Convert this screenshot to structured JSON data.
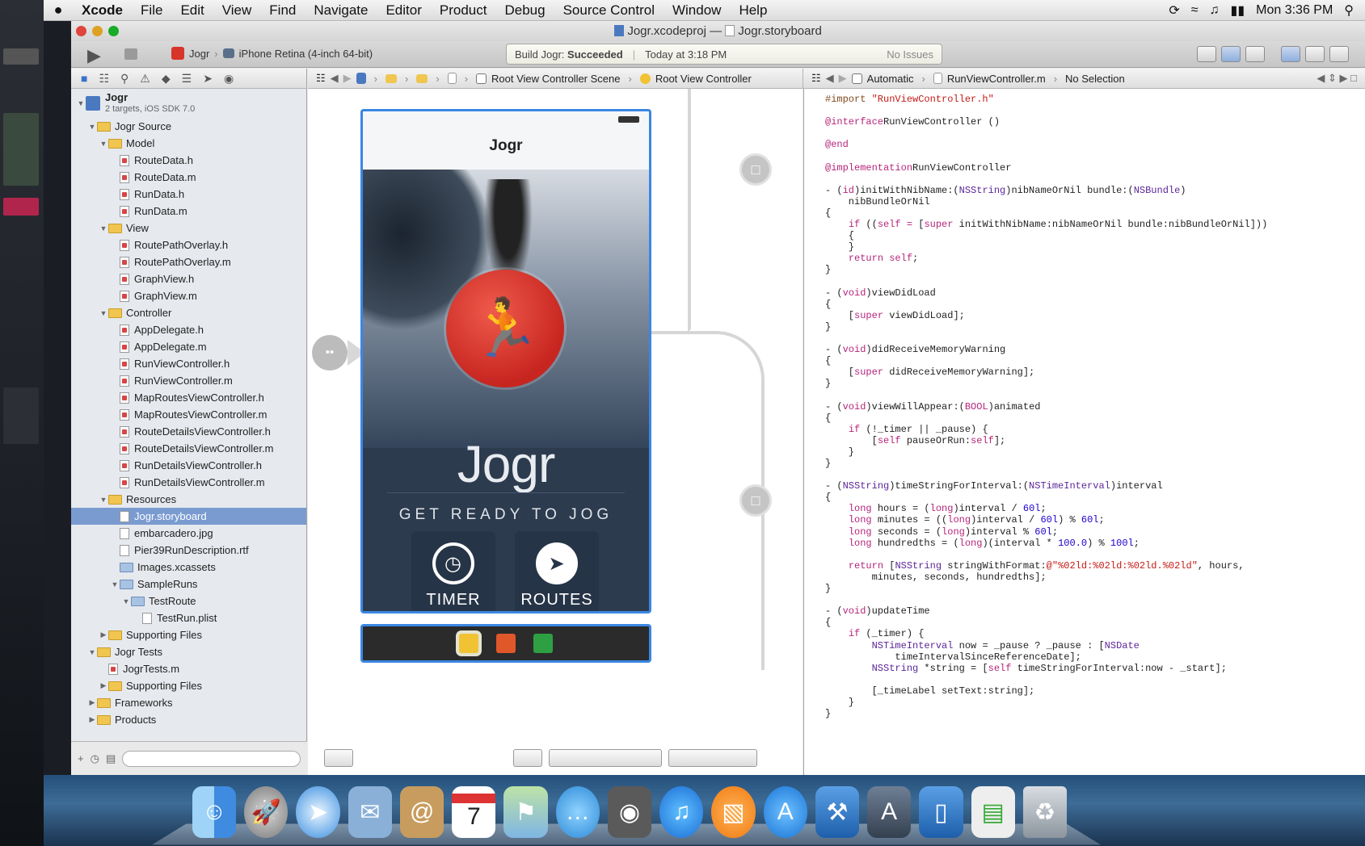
{
  "menubar": {
    "apple": "",
    "app": "Xcode",
    "items": [
      "File",
      "Edit",
      "View",
      "Find",
      "Navigate",
      "Editor",
      "Product",
      "Debug",
      "Source Control",
      "Window",
      "Help"
    ],
    "clock": "Mon 3:36 PM"
  },
  "window": {
    "title_project": "Jogr.xcodeproj",
    "title_sep": "—",
    "title_file": "Jogr.storyboard"
  },
  "toolbar": {
    "scheme": "Jogr",
    "device": "iPhone Retina (4-inch 64-bit)",
    "status_build": "Build Jogr:",
    "status_result": "Succeeded",
    "status_time": "Today at 3:18 PM",
    "status_issues": "No Issues"
  },
  "navigator": {
    "project_name": "Jogr",
    "project_sub": "2 targets, iOS SDK 7.0",
    "items": [
      {
        "label": "Jogr Source",
        "kind": "folder",
        "level": 1,
        "open": true
      },
      {
        "label": "Model",
        "kind": "folder",
        "level": 2,
        "open": true
      },
      {
        "label": "RouteData.h",
        "kind": "h",
        "level": 3
      },
      {
        "label": "RouteData.m",
        "kind": "m",
        "level": 3
      },
      {
        "label": "RunData.h",
        "kind": "h",
        "level": 3
      },
      {
        "label": "RunData.m",
        "kind": "m",
        "level": 3
      },
      {
        "label": "View",
        "kind": "folder",
        "level": 2,
        "open": true
      },
      {
        "label": "RoutePathOverlay.h",
        "kind": "h",
        "level": 3
      },
      {
        "label": "RoutePathOverlay.m",
        "kind": "m",
        "level": 3
      },
      {
        "label": "GraphView.h",
        "kind": "h",
        "level": 3
      },
      {
        "label": "GraphView.m",
        "kind": "m",
        "level": 3
      },
      {
        "label": "Controller",
        "kind": "folder",
        "level": 2,
        "open": true
      },
      {
        "label": "AppDelegate.h",
        "kind": "h",
        "level": 3
      },
      {
        "label": "AppDelegate.m",
        "kind": "m",
        "level": 3
      },
      {
        "label": "RunViewController.h",
        "kind": "h",
        "level": 3
      },
      {
        "label": "RunViewController.m",
        "kind": "m",
        "level": 3
      },
      {
        "label": "MapRoutesViewController.h",
        "kind": "h",
        "level": 3
      },
      {
        "label": "MapRoutesViewController.m",
        "kind": "m",
        "level": 3
      },
      {
        "label": "RouteDetailsViewController.h",
        "kind": "h",
        "level": 3
      },
      {
        "label": "RouteDetailsViewController.m",
        "kind": "m",
        "level": 3
      },
      {
        "label": "RunDetailsViewController.h",
        "kind": "h",
        "level": 3
      },
      {
        "label": "RunDetailsViewController.m",
        "kind": "m",
        "level": 3
      },
      {
        "label": "Resources",
        "kind": "folder",
        "level": 2,
        "open": true
      },
      {
        "label": "Jogr.storyboard",
        "kind": "file",
        "level": 3,
        "selected": true
      },
      {
        "label": "embarcadero.jpg",
        "kind": "file",
        "level": 3
      },
      {
        "label": "Pier39RunDescription.rtf",
        "kind": "file",
        "level": 3
      },
      {
        "label": "Images.xcassets",
        "kind": "bluefolder",
        "level": 3
      },
      {
        "label": "SampleRuns",
        "kind": "bluefolder",
        "level": 3,
        "open": true
      },
      {
        "label": "TestRoute",
        "kind": "bluefolder",
        "level": 4,
        "open": true
      },
      {
        "label": "TestRun.plist",
        "kind": "file",
        "level": 5
      },
      {
        "label": "Supporting Files",
        "kind": "folder",
        "level": 2,
        "open": false
      },
      {
        "label": "Jogr Tests",
        "kind": "folder",
        "level": 1,
        "open": true
      },
      {
        "label": "JogrTests.m",
        "kind": "m",
        "level": 2
      },
      {
        "label": "Supporting Files",
        "kind": "folder",
        "level": 2,
        "open": false
      },
      {
        "label": "Frameworks",
        "kind": "folder",
        "level": 1,
        "open": false
      },
      {
        "label": "Products",
        "kind": "folder",
        "level": 1,
        "open": false
      }
    ]
  },
  "jumpbar": {
    "scene": "Root View Controller Scene",
    "controller": "Root View Controller",
    "mode": "Automatic",
    "file": "RunViewController.m",
    "selection": "No Selection"
  },
  "scene": {
    "nav_title": "Jogr",
    "app_name": "Jogr",
    "tagline": "GET READY TO JOG",
    "timer_label": "TIMER",
    "routes_label": "ROUTES"
  },
  "code": [
    [
      [
        "pp",
        "#import "
      ],
      [
        "str",
        "\"RunViewController.h\""
      ]
    ],
    [],
    [
      [
        "kw",
        "@interface"
      ],
      [
        "",
        "RunViewController ()"
      ]
    ],
    [],
    [
      [
        "kw",
        "@end"
      ]
    ],
    [],
    [
      [
        "kw",
        "@implementation"
      ],
      [
        "",
        "RunViewController"
      ]
    ],
    [],
    [
      [
        "",
        "- ("
      ],
      [
        "kw",
        "id"
      ],
      [
        "",
        ")initWithNibName:("
      ],
      [
        "cls",
        "NSString"
      ],
      [
        "",
        ")nibNameOrNil bundle:("
      ],
      [
        "cls",
        "NSBundle"
      ],
      [
        "",
        ")"
      ]
    ],
    [
      [
        "",
        "    nibBundleOrNil"
      ]
    ],
    [
      [
        "",
        "{"
      ]
    ],
    [
      [
        "",
        "    "
      ],
      [
        "kw",
        "if"
      ],
      [
        "",
        " (("
      ],
      [
        "kw",
        "self"
      ],
      [
        "",
        ""
      ],
      [
        "kw",
        " = "
      ],
      [
        "",
        "["
      ],
      [
        "kw",
        "super"
      ],
      [
        "",
        " initWithNibName:nibNameOrNil bundle:nibBundleOrNil]))"
      ]
    ],
    [
      [
        "",
        "    {"
      ]
    ],
    [
      [
        "",
        "    }"
      ]
    ],
    [
      [
        "",
        "    "
      ],
      [
        "kw",
        "return"
      ],
      [
        "",
        " "
      ],
      [
        "kw",
        "self"
      ],
      [
        "",
        ";"
      ]
    ],
    [
      [
        "",
        "}"
      ]
    ],
    [],
    [
      [
        "",
        "- ("
      ],
      [
        "kw",
        "void"
      ],
      [
        "",
        ")viewDidLoad"
      ]
    ],
    [
      [
        "",
        "{"
      ]
    ],
    [
      [
        "",
        "    ["
      ],
      [
        "kw",
        "super"
      ],
      [
        "",
        " viewDidLoad];"
      ]
    ],
    [
      [
        "",
        "}"
      ]
    ],
    [],
    [
      [
        "",
        "- ("
      ],
      [
        "kw",
        "void"
      ],
      [
        "",
        ")didReceiveMemoryWarning"
      ]
    ],
    [
      [
        "",
        "{"
      ]
    ],
    [
      [
        "",
        "    ["
      ],
      [
        "kw",
        "super"
      ],
      [
        "",
        " didReceiveMemoryWarning];"
      ]
    ],
    [
      [
        "",
        "}"
      ]
    ],
    [],
    [
      [
        "",
        "- ("
      ],
      [
        "kw",
        "void"
      ],
      [
        "",
        ")viewWillAppear:("
      ],
      [
        "kw",
        "BOOL"
      ],
      [
        "",
        ")animated"
      ]
    ],
    [
      [
        "",
        "{"
      ]
    ],
    [
      [
        "",
        "    "
      ],
      [
        "kw",
        "if"
      ],
      [
        "",
        " (!_timer || _pause) {"
      ]
    ],
    [
      [
        "",
        "        ["
      ],
      [
        "kw",
        "self"
      ],
      [
        "",
        " pauseOrRun:"
      ],
      [
        "kw",
        "self"
      ],
      [
        "",
        "];"
      ]
    ],
    [
      [
        "",
        "    }"
      ]
    ],
    [
      [
        "",
        "}"
      ]
    ],
    [],
    [
      [
        "",
        "- ("
      ],
      [
        "cls",
        "NSString"
      ],
      [
        "",
        ")timeStringForInterval:("
      ],
      [
        "cls",
        "NSTimeInterval"
      ],
      [
        "",
        ")interval"
      ]
    ],
    [
      [
        "",
        "{"
      ]
    ],
    [
      [
        "",
        "    "
      ],
      [
        "kw",
        "long"
      ],
      [
        "",
        " hours = ("
      ],
      [
        "kw",
        "long"
      ],
      [
        "",
        ")interval / "
      ],
      [
        "num",
        "60l"
      ],
      [
        "",
        ";"
      ]
    ],
    [
      [
        "",
        "    "
      ],
      [
        "kw",
        "long"
      ],
      [
        "",
        " minutes = (("
      ],
      [
        "kw",
        "long"
      ],
      [
        "",
        ")interval / "
      ],
      [
        "num",
        "60l"
      ],
      [
        "",
        ") % "
      ],
      [
        "num",
        "60l"
      ],
      [
        "",
        ";"
      ]
    ],
    [
      [
        "",
        "    "
      ],
      [
        "kw",
        "long"
      ],
      [
        "",
        " seconds = ("
      ],
      [
        "kw",
        "long"
      ],
      [
        "",
        ")interval % "
      ],
      [
        "num",
        "60l"
      ],
      [
        "",
        ";"
      ]
    ],
    [
      [
        "",
        "    "
      ],
      [
        "kw",
        "long"
      ],
      [
        "",
        " hundredths = ("
      ],
      [
        "kw",
        "long"
      ],
      [
        "",
        ")(interval * "
      ],
      [
        "num",
        "100.0"
      ],
      [
        "",
        ") % "
      ],
      [
        "num",
        "100l"
      ],
      [
        "",
        ";"
      ]
    ],
    [],
    [
      [
        "",
        "    "
      ],
      [
        "kw",
        "return"
      ],
      [
        "",
        " ["
      ],
      [
        "cls",
        "NSString"
      ],
      [
        "",
        " stringWithFormat:"
      ],
      [
        "str",
        "@\"%02ld:%02ld:%02ld.%02ld\""
      ],
      [
        "",
        ", hours,"
      ]
    ],
    [
      [
        "",
        "        minutes, seconds, hundredths];"
      ]
    ],
    [
      [
        "",
        "}"
      ]
    ],
    [],
    [
      [
        "",
        "- ("
      ],
      [
        "kw",
        "void"
      ],
      [
        "",
        ")updateTime"
      ]
    ],
    [
      [
        "",
        "{"
      ]
    ],
    [
      [
        "",
        "    "
      ],
      [
        "kw",
        "if"
      ],
      [
        "",
        " (_timer) {"
      ]
    ],
    [
      [
        "",
        "        "
      ],
      [
        "cls",
        "NSTimeInterval"
      ],
      [
        "",
        " now = _pause ? _pause : ["
      ],
      [
        "cls",
        "NSDate"
      ]
    ],
    [
      [
        "",
        "            timeIntervalSinceReferenceDate];"
      ]
    ],
    [
      [
        "",
        "        "
      ],
      [
        "cls",
        "NSString"
      ],
      [
        "",
        " *string = ["
      ],
      [
        "kw",
        "self"
      ],
      [
        "",
        " timeStringForInterval:now - _start];"
      ]
    ],
    [],
    [
      [
        "",
        "        [_timeLabel setText:string];"
      ]
    ],
    [
      [
        "",
        "    }"
      ]
    ],
    [
      [
        "",
        "}"
      ]
    ]
  ],
  "dock": [
    "Finder",
    "Launchpad",
    "Safari",
    "Mail",
    "Contacts",
    "Calendar",
    "Maps",
    "Messages",
    "FaceTime",
    "iTunes",
    "iBooks",
    "App Store",
    "Xcode",
    "Instruments",
    "iOS Simulator",
    "Preview",
    "Trash"
  ],
  "dock_calendar_day": "7",
  "colors": {
    "accent": "#3b87e3",
    "logo_red": "#d7342a",
    "selection": "#7a9bd0"
  }
}
